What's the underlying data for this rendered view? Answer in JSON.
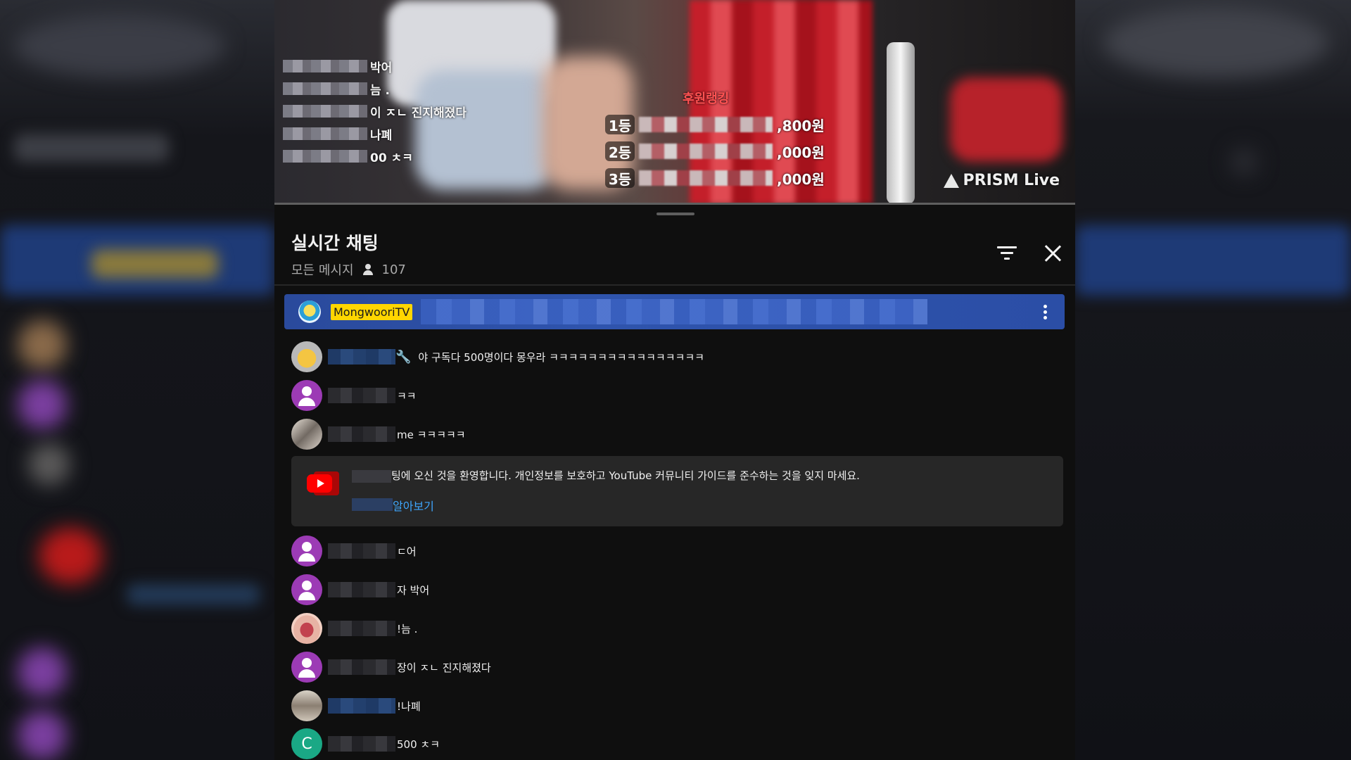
{
  "video": {
    "overlay_chat": [
      "박어",
      "늠 .",
      "이 ㅈㄴ 진지해졌다",
      "나폐",
      "00 ㅊㅋ"
    ],
    "ranking_title": "후원랭킹",
    "ranking": [
      {
        "rank": "1등",
        "amount": ",800원"
      },
      {
        "rank": "2등",
        "amount": ",000원"
      },
      {
        "rank": "3등",
        "amount": ",000원"
      }
    ],
    "watermark": "PRISM Live"
  },
  "chat": {
    "title": "실시간 채팅",
    "filter_label": "모든 메시지",
    "viewer_count": "107",
    "pinned_author": "MongwooriTV",
    "messages": [
      {
        "text": "야 구독다 500명이다 몽우라 ㅋㅋㅋㅋㅋㅋㅋㅋㅋㅋㅋㅋㅋㅋㅋㅋ"
      },
      {
        "text": "ㅋㅋ"
      },
      {
        "text": "me ㅋㅋㅋㅋㅋ"
      }
    ],
    "system_message": {
      "text": "팅에 오신 것을 환영합니다. 개인정보를 보호하고 YouTube 커뮤니티 가이드를 준수하는 것을 잊지 마세요.",
      "link": "알아보기"
    },
    "messages_after": [
      {
        "text": "ㄷ어"
      },
      {
        "text": "자 박어"
      },
      {
        "text": "!늠 ."
      },
      {
        "text": "장이 ㅈㄴ 진지해졌다"
      },
      {
        "text": "!나폐"
      },
      {
        "text": "500 ㅊㅋ"
      }
    ],
    "avatar_letter": "C"
  },
  "colors": {
    "pinned_bg": "#2f54ad",
    "author_badge": "#ffd600",
    "link": "#3ea6ff",
    "default_avatar": "#9c3bb5"
  }
}
